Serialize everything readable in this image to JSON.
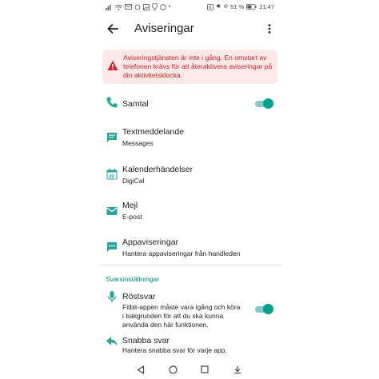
{
  "status_bar": {
    "battery": "51 %",
    "time": "21:47"
  },
  "app_bar": {
    "title": "Aviseringar",
    "back_icon": "arrow-left-icon",
    "more_icon": "more-vertical-icon"
  },
  "alert": {
    "text": "Aviseringstjänsten är inte i gång. En omstart av telefonen krävs för att återaktivera aviseringar på din aktivitetsklocka.",
    "color": "#c62828",
    "background": "#fde8e8"
  },
  "items": [
    {
      "id": "calls",
      "icon": "phone-icon",
      "title": "Samtal",
      "subtitle": "",
      "toggle": true
    },
    {
      "id": "texts",
      "icon": "message-icon",
      "title": "Textmeddelande",
      "subtitle": "Messages",
      "toggle": false
    },
    {
      "id": "calendar",
      "icon": "calendar-icon",
      "title": "Kalenderhändelser",
      "subtitle": "DigiCal",
      "toggle": false
    },
    {
      "id": "email",
      "icon": "mail-icon",
      "title": "Mejl",
      "subtitle": "E-post",
      "toggle": false
    },
    {
      "id": "apps",
      "icon": "app-notification-icon",
      "title": "Appaviseringar",
      "subtitle": "Hantera appaviseringar från handleden",
      "toggle": false
    }
  ],
  "reply_section": {
    "header": "Svarsinställningar",
    "items": [
      {
        "id": "voice",
        "icon": "microphone-icon",
        "title": "Röstsvar",
        "subtitle": "Fitbit-appen måste vara igång och köra i bakgrunden för att du ska kunna använda den här funktionen.",
        "toggle": true
      },
      {
        "id": "quick",
        "icon": "reply-icon",
        "title": "Snabba svar",
        "subtitle": "Hantera snabba svar för varje app.",
        "toggle": false
      }
    ]
  },
  "colors": {
    "accent": "#00a08a",
    "accent_light": "#80cbc4",
    "section_header": "#00897b",
    "icon": "#26a69a"
  }
}
